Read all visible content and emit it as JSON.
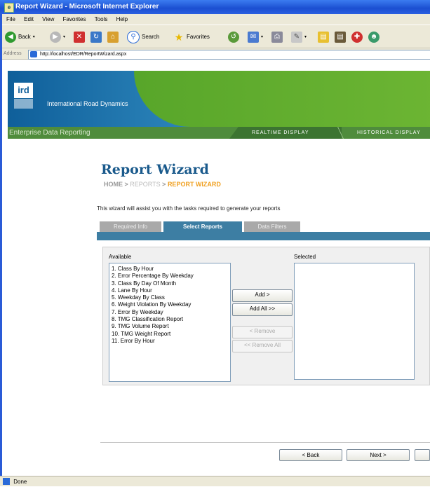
{
  "window": {
    "title": "Report Wizard - Microsoft Internet Explorer"
  },
  "menu": [
    "File",
    "Edit",
    "View",
    "Favorites",
    "Tools",
    "Help"
  ],
  "toolbar": {
    "back_label": "Back",
    "search_label": "Search",
    "favorites_label": "Favorites"
  },
  "address": {
    "label": "Address",
    "url": "http://localhost/EDR/ReportWizard.aspx"
  },
  "banner": {
    "logo_text": "ird",
    "company": "International Road Dynamics"
  },
  "nav": {
    "brand": "Enterprise Data Reporting",
    "realtime": "Realtime Display",
    "historical": "Historical Display"
  },
  "page": {
    "title": "Report Wizard",
    "breadcrumb": {
      "home": "HOME",
      "sep": ">",
      "reports": "REPORTS",
      "current": "REPORT WIZARD"
    },
    "intro": "This wizard will assist you with the tasks required to generate your reports"
  },
  "tabs": [
    {
      "label": "Required Info",
      "active": false
    },
    {
      "label": "Select Reports",
      "active": true
    },
    {
      "label": "Data Filters",
      "active": false
    }
  ],
  "available_label": "Available",
  "selected_label": "Selected",
  "available_items": [
    "1. Class By Hour",
    "2. Error Percentage By Weekday",
    "3. Class By Day Of Month",
    "4. Lane By Hour",
    "5. Weekday By Class",
    "6. Weight Violation By Weekday",
    "7. Error By Weekday",
    "8. TMG Classification Report",
    "9. TMG Volume Report",
    "10. TMG Weight Report",
    "11. Error By Hour"
  ],
  "buttons": {
    "add": "Add >",
    "add_all": "Add All >>",
    "remove": "< Remove",
    "remove_all": "<< Remove All",
    "back": "< Back",
    "next": "Next >"
  },
  "status": {
    "text": "Done"
  },
  "colors": {
    "title_blue": "#1a5a8c",
    "breadcrumb_orange": "#f0a020",
    "tab_blue": "#3d7ea3",
    "nav_green": "#4f8c3c"
  }
}
